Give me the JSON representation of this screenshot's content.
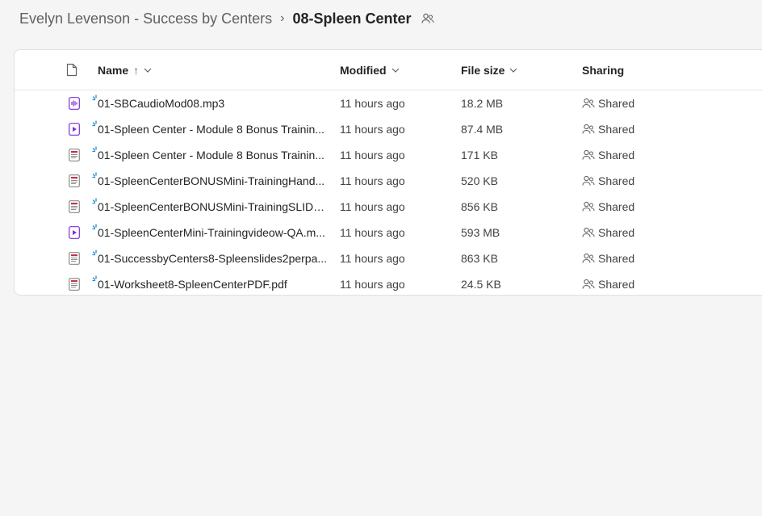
{
  "breadcrumb": {
    "parent": "Evelyn Levenson - Success by Centers",
    "separator": "›",
    "current": "08-Spleen Center"
  },
  "table": {
    "columns": {
      "name": "Name",
      "sort_indicator": "↑",
      "modified": "Modified",
      "file_size": "File size",
      "sharing": "Sharing"
    },
    "rows": [
      {
        "icon": "audio-file-icon",
        "name": "01-SBCaudioMod08.mp3",
        "modified": "11 hours ago",
        "size": "18.2 MB",
        "sharing": "Shared"
      },
      {
        "icon": "video-file-icon",
        "name": "01-Spleen Center - Module 8 Bonus Trainin...",
        "modified": "11 hours ago",
        "size": "87.4 MB",
        "sharing": "Shared"
      },
      {
        "icon": "pdf-file-icon",
        "name": "01-Spleen Center - Module 8 Bonus Trainin...",
        "modified": "11 hours ago",
        "size": "171 KB",
        "sharing": "Shared"
      },
      {
        "icon": "pdf-file-icon",
        "name": "01-SpleenCenterBONUSMini-TrainingHand...",
        "modified": "11 hours ago",
        "size": "520 KB",
        "sharing": "Shared"
      },
      {
        "icon": "pdf-file-icon",
        "name": "01-SpleenCenterBONUSMini-TrainingSLIDE...",
        "modified": "11 hours ago",
        "size": "856 KB",
        "sharing": "Shared"
      },
      {
        "icon": "video-file-icon",
        "name": "01-SpleenCenterMini-Trainingvideow-QA.m...",
        "modified": "11 hours ago",
        "size": "593 MB",
        "sharing": "Shared"
      },
      {
        "icon": "pdf-file-icon",
        "name": "01-SuccessbyCenters8-Spleenslides2perpa...",
        "modified": "11 hours ago",
        "size": "863 KB",
        "sharing": "Shared"
      },
      {
        "icon": "pdf-file-icon",
        "name": "01-Worksheet8-SpleenCenterPDF.pdf",
        "modified": "11 hours ago",
        "size": "24.5 KB",
        "sharing": "Shared"
      }
    ]
  },
  "colors": {
    "accent": "#7b2fd6",
    "pdf_red": "#c4314b",
    "new_indicator": "#1a8fd0"
  }
}
